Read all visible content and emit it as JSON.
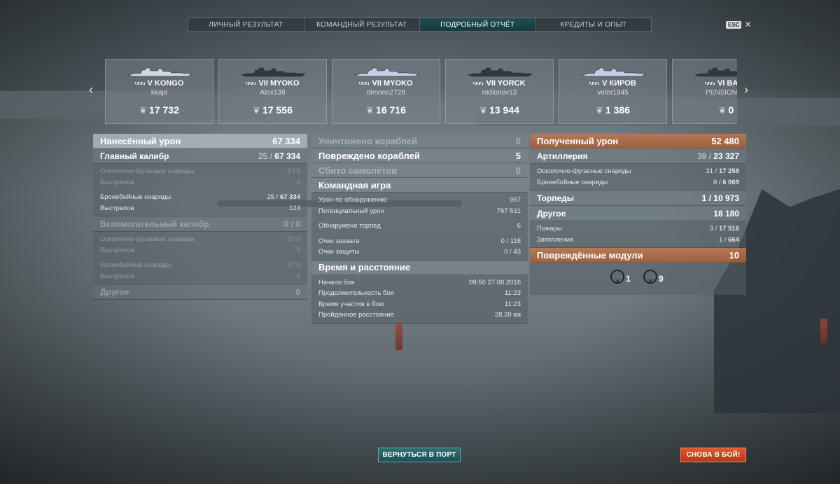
{
  "tabs": [
    {
      "label": "ЛИЧНЫЙ РЕЗУЛЬТАТ",
      "active": false
    },
    {
      "label": "КОМАНДНЫЙ РЕЗУЛЬТАТ",
      "active": false
    },
    {
      "label": "ПОДРОБНЫЙ ОТЧЁТ",
      "active": true
    },
    {
      "label": "КРЕДИТЫ И ОПЫТ",
      "active": false
    }
  ],
  "esc": {
    "key": "ESC",
    "close": "✕"
  },
  "nav": {
    "prev": "‹",
    "next": "›"
  },
  "ships": [
    {
      "name": "V KONGO",
      "player": "kkapl",
      "score": "17 732",
      "color": "#cfd8dc"
    },
    {
      "name": "VII MYOKO",
      "player": "Alex138",
      "score": "17 556",
      "color": "#2e3a40"
    },
    {
      "name": "VII MYOKO",
      "player": "dimonn2728",
      "score": "16 716",
      "color": "#c9cbe8"
    },
    {
      "name": "VII YORCK",
      "player": "rodionov13",
      "score": "13 944",
      "color": "#2e3a40"
    },
    {
      "name": "V КИРОВ",
      "player": "veter1945",
      "score": "1 386",
      "color": "#c9cbe8"
    },
    {
      "name": "VI BAYE",
      "player": "PENSIONER",
      "score": "0",
      "color": "#2e3a40"
    }
  ],
  "left": {
    "damage_dealt": {
      "label": "Нанесённый урон",
      "value": "67 334"
    },
    "main_battery": {
      "label": "Главный калибр",
      "value_a": "25 / ",
      "value_b": "67 334"
    },
    "mb_he": {
      "label": "Осколочно-фугасные снаряды",
      "value": "0 / 0"
    },
    "mb_he_shots": {
      "label": "Выстрелов",
      "value": "0"
    },
    "mb_ap": {
      "label": "Бронебойные снаряды",
      "value_a": "25 / ",
      "value_b": "67 334"
    },
    "mb_ap_shots": {
      "label": "Выстрелов",
      "value": "124"
    },
    "secondary": {
      "label": "Вспомогательный калибр",
      "value": "0 / 0"
    },
    "sec_he": {
      "label": "Осколочно-фугасные снаряды",
      "value": "0 / 0"
    },
    "sec_he_shots": {
      "label": "Выстрелов",
      "value": "0"
    },
    "sec_ap": {
      "label": "Бронебойные снаряды",
      "value": "0 / 0"
    },
    "sec_ap_shots": {
      "label": "Выстрелов",
      "value": "0"
    },
    "other": {
      "label": "Другое",
      "value": "0"
    }
  },
  "mid": {
    "destroyed": {
      "label": "Уничтожено кораблей",
      "value": "0"
    },
    "damaged": {
      "label": "Повреждено кораблей",
      "value": "5"
    },
    "planes": {
      "label": "Сбито самолётов",
      "value": "0"
    },
    "team_play": {
      "label": "Командная игра"
    },
    "spotting_damage": {
      "label": "Урон по обнаружению",
      "value": "957"
    },
    "potential_damage": {
      "label": "Потенциальный урон",
      "value": "767 531"
    },
    "torpedoes_spotted": {
      "label": "Обнаружено торпед",
      "value": "6"
    },
    "capture_points": {
      "label": "Очки захвата",
      "value": "0 / 118"
    },
    "defense_points": {
      "label": "Очки защиты",
      "value": "0 / 43"
    },
    "time_distance": {
      "label": "Время и расстояние"
    },
    "battle_start": {
      "label": "Начало боя",
      "value": "09:50  27.08.2016"
    },
    "battle_duration": {
      "label": "Продолжительность боя",
      "value": "11:23"
    },
    "time_in_battle": {
      "label": "Время участия в бою",
      "value": "11:23"
    },
    "distance": {
      "label": "Пройденное расстояние",
      "value": "28.39 км"
    }
  },
  "right": {
    "damage_received": {
      "label": "Полученный урон",
      "value": "52 480"
    },
    "artillery": {
      "label": "Артиллерия",
      "value_a": "39 / ",
      "value_b": "23 327"
    },
    "art_he": {
      "label": "Осколочно-фугасные снаряды",
      "value_a": "31 / ",
      "value_b": "17 258"
    },
    "art_ap": {
      "label": "Бронебойные снаряды",
      "value_a": "8 / ",
      "value_b": "6 069"
    },
    "torpedoes": {
      "label": "Торпеды",
      "value": "1 / 10 973"
    },
    "other": {
      "label": "Другое",
      "value": "18 180"
    },
    "fires": {
      "label": "Пожары",
      "value_a": "3 / ",
      "value_b": "17 516"
    },
    "flooding": {
      "label": "Затопления",
      "value_a": "1 / ",
      "value_b": "664"
    },
    "damaged_modules": {
      "label": "Повреждённые модули",
      "value": "10"
    },
    "module_icons": [
      {
        "icon": "gun-module-destroyed-icon",
        "count": "1"
      },
      {
        "icon": "engine-module-destroyed-icon",
        "count": "9"
      }
    ]
  },
  "buttons": {
    "return_port": "ВЕРНУТЬСЯ В ПОРТ",
    "battle_again": "СНОВА В БОЙ!"
  }
}
